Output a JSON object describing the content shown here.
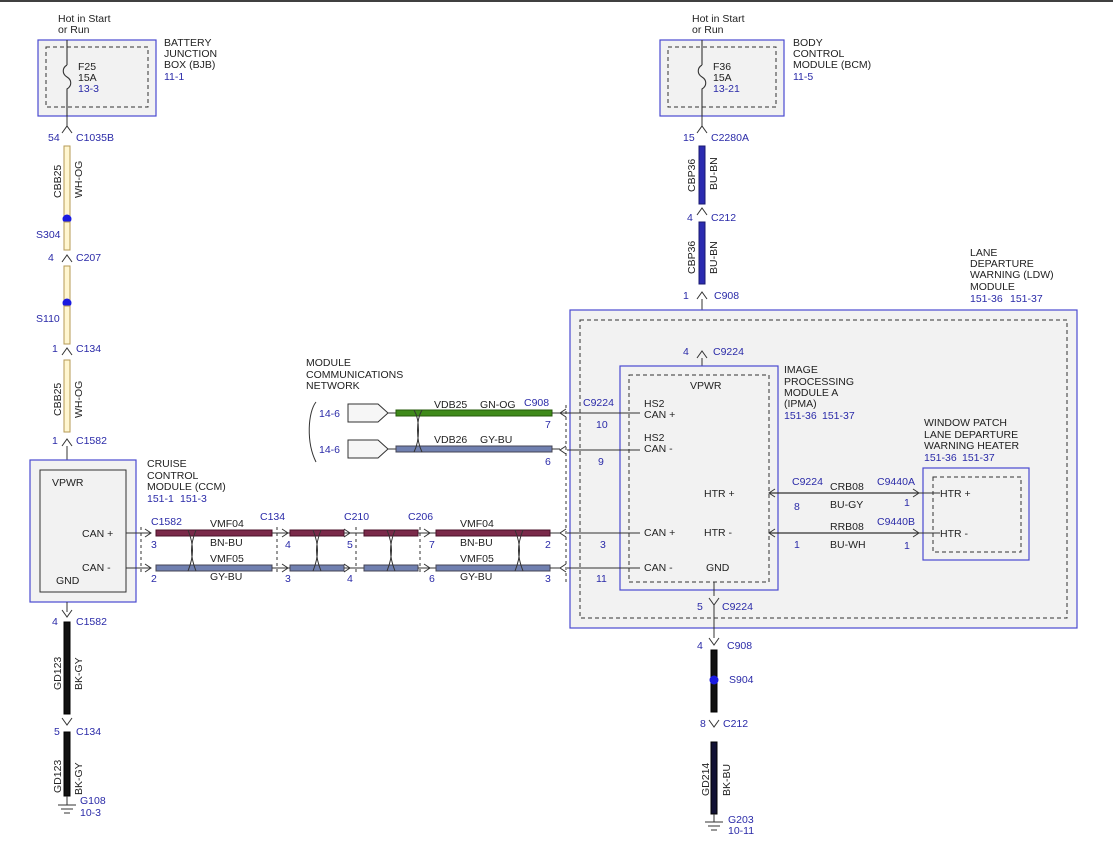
{
  "colors": {
    "module_border": "#4a4ad0",
    "module_fill": "#f2f2f2",
    "reference_text": "#2a2aa8",
    "wire_wh_og_outer": "#b59a55",
    "wire_wh_og_inner": "#fff6d0",
    "wire_bu_bn": "#2b2bb0",
    "wire_bk_gy": "#111111",
    "wire_bk_bu": "#111133",
    "wire_gn_og": "#3f8a1a",
    "wire_gy_bu": "#7080b0",
    "wire_bn_bu": "#7a2a4a",
    "splice": "#1a1ae0"
  },
  "bjb": {
    "hot_line1": "Hot in Start",
    "hot_line2": "or Run",
    "fuse_id": "F25",
    "fuse_amps": "15A",
    "fuse_ref": "13-3",
    "name_line1": "BATTERY",
    "name_line2": "JUNCTION",
    "name_line3": "BOX (BJB)",
    "name_ref": "11-1"
  },
  "bcm": {
    "hot_line1": "Hot in Start",
    "hot_line2": "or Run",
    "fuse_id": "F36",
    "fuse_amps": "15A",
    "fuse_ref": "13-21",
    "name_line1": "BODY",
    "name_line2": "CONTROL",
    "name_line3": "MODULE (BCM)",
    "name_ref": "11-5"
  },
  "left_feed": {
    "pin_c1035b": "54",
    "conn_c1035b": "C1035B",
    "circuit1": "CBB25",
    "color1": "WH-OG",
    "splice_s304": "S304",
    "pin_c207": "4",
    "conn_c207": "C207",
    "splice_s110": "S110",
    "pin_c134": "1",
    "conn_c134": "C134",
    "circuit2": "CBB25",
    "color2": "WH-OG",
    "pin_c1582": "1",
    "conn_c1582": "C1582"
  },
  "right_feed": {
    "pin_c2280a": "15",
    "conn_c2280a": "C2280A",
    "circuit1": "CBP36",
    "color1": "BU-BN",
    "pin_c212": "4",
    "conn_c212": "C212",
    "circuit2": "CBP36",
    "color2": "BU-BN",
    "pin_c908": "1",
    "conn_c908": "C908"
  },
  "ccm": {
    "vpwr": "VPWR",
    "can_plus": "CAN +",
    "can_minus": "CAN -",
    "gnd": "GND",
    "name_line1": "CRUISE",
    "name_line2": "CONTROL",
    "name_line3": "MODULE (CCM)",
    "name_ref1": "151-1",
    "name_ref2": "151-3"
  },
  "ldw": {
    "name_line1": "LANE",
    "name_line2": "DEPARTURE",
    "name_line3": "WARNING (LDW)",
    "name_line4": "MODULE",
    "name_ref1": "151-36",
    "name_ref2": "151-37",
    "pin_top": "4",
    "conn_top": "C9224",
    "pin_bottom": "5",
    "conn_bottom": "C9224"
  },
  "ipma": {
    "vpwr": "VPWR",
    "hs2_plus_1": "HS2",
    "hs2_plus_2": "CAN +",
    "hs2_minus_1": "HS2",
    "hs2_minus_2": "CAN -",
    "htr_plus": "HTR +",
    "htr_minus": "HTR -",
    "can_plus": "CAN +",
    "can_minus": "CAN -",
    "gnd": "GND",
    "name_line1": "IMAGE",
    "name_line2": "PROCESSING",
    "name_line3": "MODULE A",
    "name_line4": "(IPMA)",
    "name_ref1": "151-36",
    "name_ref2": "151-37",
    "conn_hs2": "C9224",
    "pin_hs2_plus": "10",
    "pin_hs2_minus": "9",
    "pin_can_plus": "3",
    "pin_can_minus": "11"
  },
  "heater": {
    "name_line1": "WINDOW PATCH",
    "name_line2": "LANE DEPARTURE",
    "name_line3": "WARNING HEATER",
    "name_ref1": "151-36",
    "name_ref2": "151-37",
    "htr_plus": "HTR +",
    "htr_minus": "HTR -",
    "conn_plus": "C9440A",
    "pin_plus": "1",
    "conn_minus": "C9440B",
    "pin_minus": "1",
    "ipma_conn": "C9224",
    "ipma_pin_plus": "8",
    "ipma_pin_minus": "1",
    "circuit_plus": "CRB08",
    "color_plus": "BU-GY",
    "circuit_minus": "RRB08",
    "color_minus": "BU-WH"
  },
  "mcn": {
    "name_line1": "MODULE",
    "name_line2": "COMMUNICATIONS",
    "name_line3": "NETWORK",
    "ref_plus": "14-6",
    "ref_minus": "14-6",
    "circuit_plus": "VDB25",
    "color_plus": "GN-OG",
    "circuit_minus": "VDB26",
    "color_minus": "GY-BU",
    "conn": "C908",
    "pin_plus": "7",
    "pin_minus": "6"
  },
  "can_bus": {
    "conn_c1582": "C1582",
    "circuit_plus_left": "VMF04",
    "color_plus_left": "BN-BU",
    "circuit_minus_left": "VMF05",
    "color_minus_left": "GY-BU",
    "pin_c1582_plus": "3",
    "pin_c1582_minus": "2",
    "conn_c134": "C134",
    "pin_c134_plus": "4",
    "pin_c134_minus": "3",
    "conn_c210": "C210",
    "pin_c210_plus": "5",
    "pin_c210_minus": "4",
    "conn_c206": "C206",
    "pin_c206_plus": "7",
    "pin_c206_minus": "6",
    "circuit_plus_right": "VMF04",
    "color_plus_right": "BN-BU",
    "circuit_minus_right": "VMF05",
    "color_minus_right": "GY-BU",
    "pin_c908_plus": "2",
    "pin_c908_minus": "3"
  },
  "left_ground": {
    "pin_c1582": "4",
    "conn_c1582": "C1582",
    "circuit1": "GD123",
    "color1": "BK-GY",
    "pin_c134": "5",
    "conn_c134": "C134",
    "circuit2": "GD123",
    "color2": "BK-GY",
    "ground": "G108",
    "ground_ref": "10-3"
  },
  "right_ground": {
    "pin_c908": "4",
    "conn_c908": "C908",
    "splice": "S904",
    "pin_c212": "8",
    "conn_c212": "C212",
    "circuit": "GD214",
    "color": "BK-BU",
    "ground": "G203",
    "ground_ref": "10-11"
  }
}
